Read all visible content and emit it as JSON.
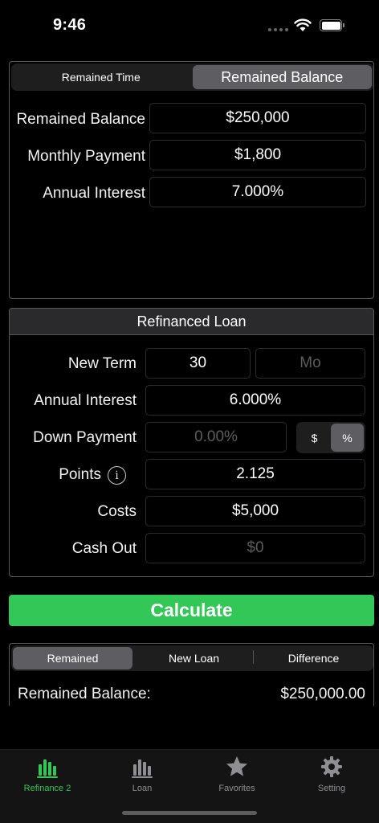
{
  "status_bar": {
    "time": "9:46"
  },
  "top_panel": {
    "segments": [
      "Remained Time",
      "Remained Balance"
    ],
    "active_segment": "Remained Balance",
    "rows": [
      {
        "label": "Remained Balance",
        "value": "$250,000"
      },
      {
        "label": "Monthly Payment",
        "value": "$1,800"
      },
      {
        "label": "Annual Interest",
        "value": "7.000%"
      }
    ]
  },
  "refinanced_loan": {
    "title": "Refinanced Loan",
    "new_term": {
      "label": "New Term",
      "value": "30",
      "unit_placeholder": "Mo"
    },
    "annual_interest": {
      "label": "Annual Interest",
      "value": "6.000%"
    },
    "down_payment": {
      "label": "Down Payment",
      "placeholder": "0.00%",
      "unit_options": [
        "$",
        "%"
      ],
      "active_unit": "%"
    },
    "points": {
      "label": "Points",
      "value": "2.125"
    },
    "costs": {
      "label": "Costs",
      "value": "$5,000"
    },
    "cash_out": {
      "label": "Cash Out",
      "placeholder": "$0"
    }
  },
  "calculate_label": "Calculate",
  "results": {
    "segments": [
      "Remained",
      "New Loan",
      "Difference"
    ],
    "active_segment": "Remained",
    "rows": [
      {
        "label": "Remained Balance:",
        "value": "$250,000.00"
      }
    ]
  },
  "tab_bar": {
    "tabs": [
      {
        "label": "Refinance 2",
        "icon": "bar-chart-icon",
        "active": true
      },
      {
        "label": "Loan",
        "icon": "bar-chart-icon",
        "active": false
      },
      {
        "label": "Favorites",
        "icon": "star-icon",
        "active": false
      },
      {
        "label": "Setting",
        "icon": "gear-icon",
        "active": false
      }
    ]
  },
  "colors": {
    "accent": "#33c758",
    "background": "#000000",
    "segment_active": "#5e5e62"
  }
}
